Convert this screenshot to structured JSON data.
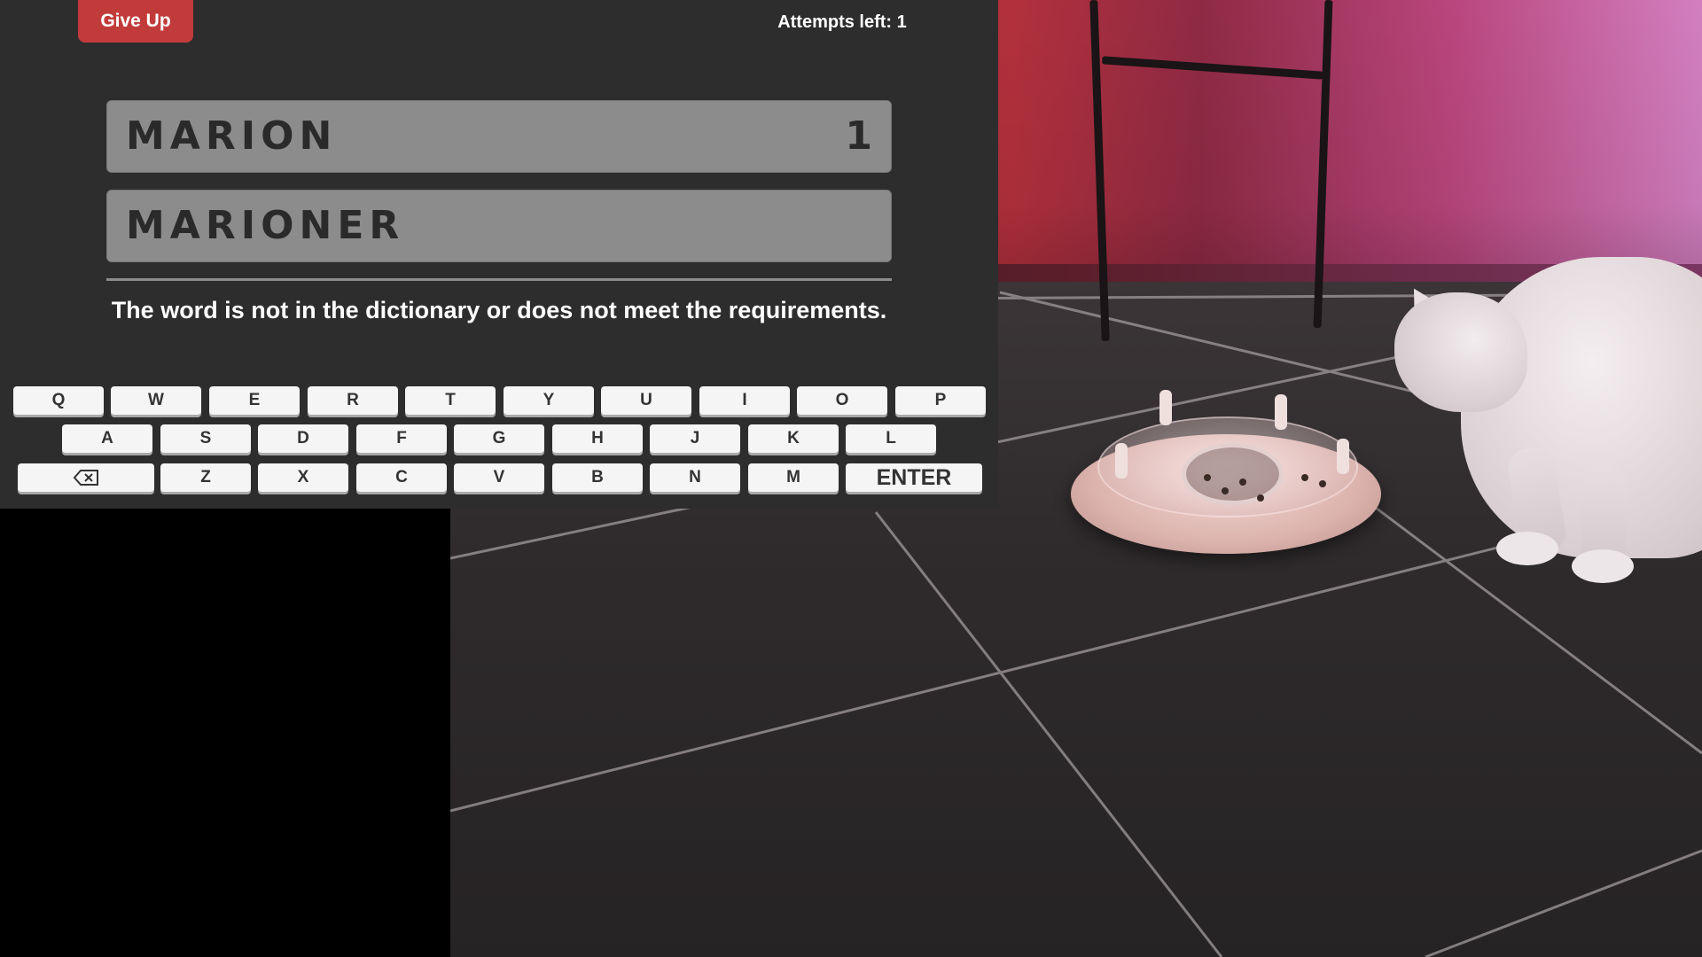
{
  "game": {
    "give_up_label": "Give Up",
    "attempts_label": "Attempts left: 1",
    "guesses": [
      {
        "word": "MARION",
        "score": "1"
      },
      {
        "word": "MARIONER",
        "score": ""
      }
    ],
    "message": "The word is not in the dictionary or does not meet the requirements."
  },
  "keyboard": {
    "row1": [
      "Q",
      "W",
      "E",
      "R",
      "T",
      "Y",
      "U",
      "I",
      "O",
      "P"
    ],
    "row2": [
      "A",
      "S",
      "D",
      "F",
      "G",
      "H",
      "J",
      "K",
      "L"
    ],
    "row3": [
      "Z",
      "X",
      "C",
      "V",
      "B",
      "N",
      "M"
    ],
    "enter_label": "ENTER",
    "backspace_icon": "backspace-icon"
  },
  "colors": {
    "panel": "#2d2d2d",
    "give_up": "#c23b3b",
    "guess_row": "#8c8c8c",
    "key": "#f5f5f5"
  }
}
